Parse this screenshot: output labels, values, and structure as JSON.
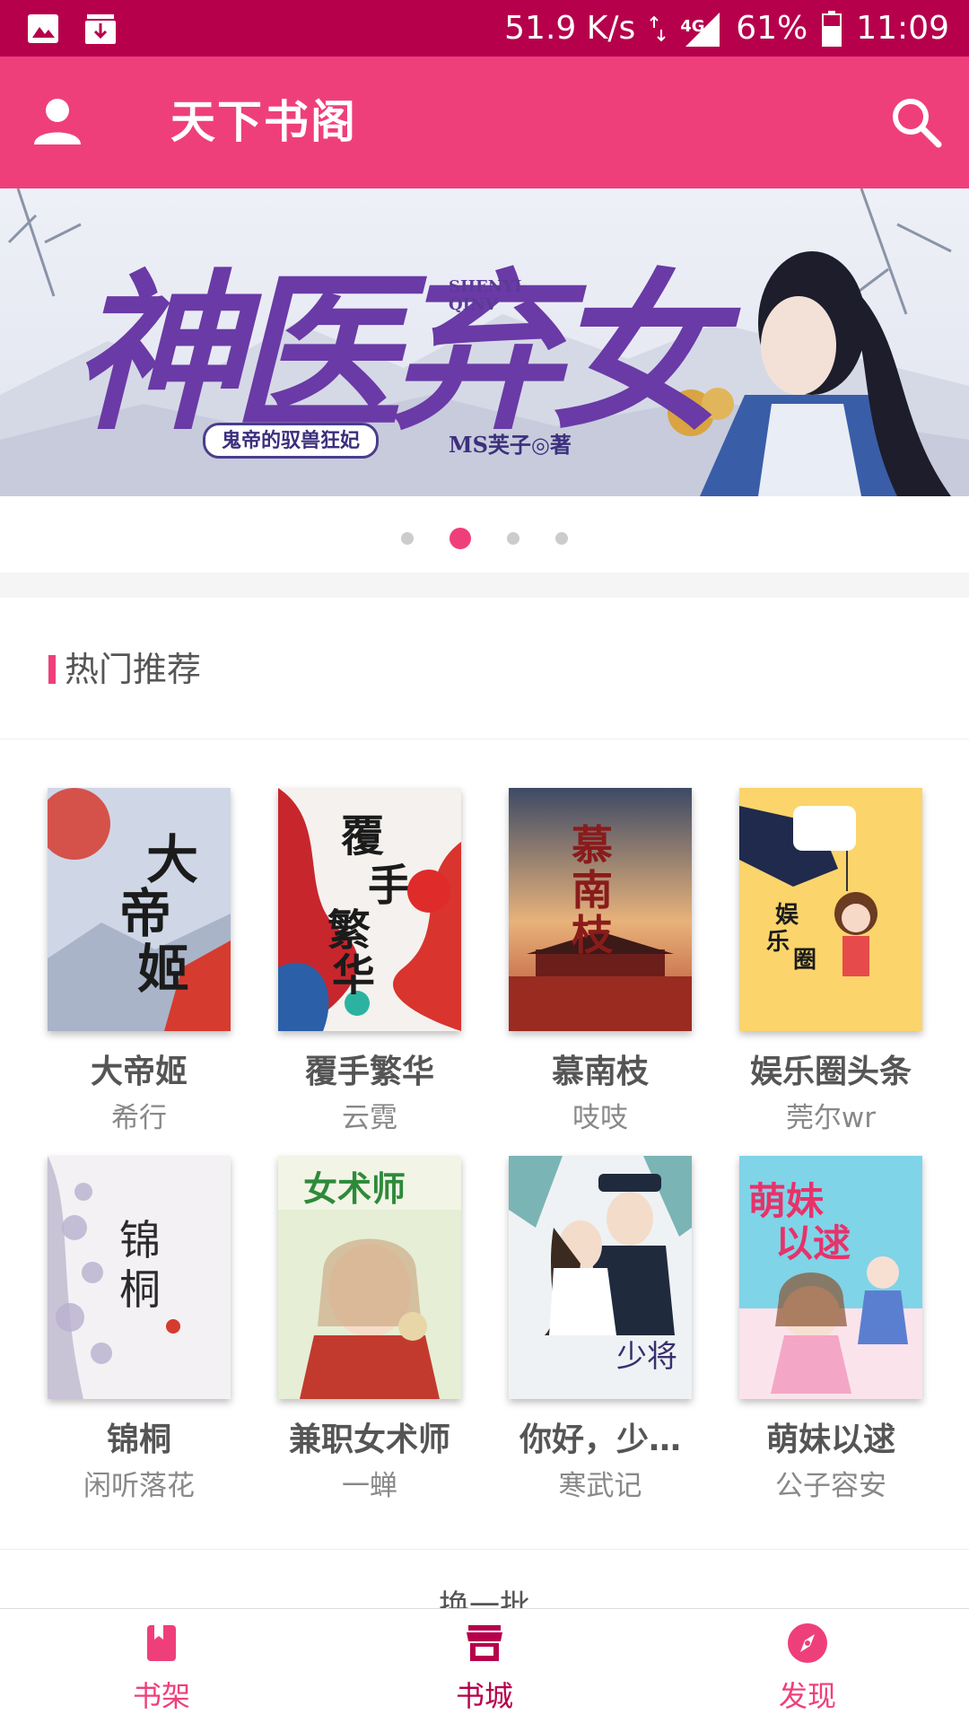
{
  "status_bar": {
    "network_speed": "51.9 K/s",
    "network_type": "4G",
    "battery": "61%",
    "time": "11:09",
    "icons": [
      "image-icon",
      "download-icon",
      "data-arrows-icon",
      "signal-icon",
      "battery-icon"
    ]
  },
  "app_bar": {
    "title": "天下书阁",
    "icons": [
      "user-icon",
      "search-icon"
    ]
  },
  "banner": {
    "title": "神医弃女",
    "title_en_1": "SHENYI",
    "title_en_2": "QINV",
    "subtitle": "鬼帝的驭兽狂妃",
    "author": "MS芙子◎著",
    "slide_count": 4,
    "active_slide": 2
  },
  "section": {
    "title": "热门推荐"
  },
  "books": [
    {
      "title": "大帝姬",
      "author": "希行"
    },
    {
      "title": "覆手繁华",
      "author": "云霓"
    },
    {
      "title": "慕南枝",
      "author": "吱吱"
    },
    {
      "title": "娱乐圈头条",
      "author": "莞尔wr"
    },
    {
      "title": "锦桐",
      "author": "闲听落花"
    },
    {
      "title": "兼职女术师",
      "author": "一蝉"
    },
    {
      "title": "你好，少…",
      "author": "寒武记"
    },
    {
      "title": "萌妹以逑",
      "author": "公子容安"
    }
  ],
  "refresh_label": "换一批",
  "bottom_nav": {
    "shelf": "书架",
    "store": "书城",
    "discover": "发现",
    "active": "store"
  },
  "colors": {
    "status_bar": "#b6004b",
    "app_bar": "#ef3f7b",
    "accent": "#ef3f7b",
    "active_nav": "#b6004b"
  }
}
